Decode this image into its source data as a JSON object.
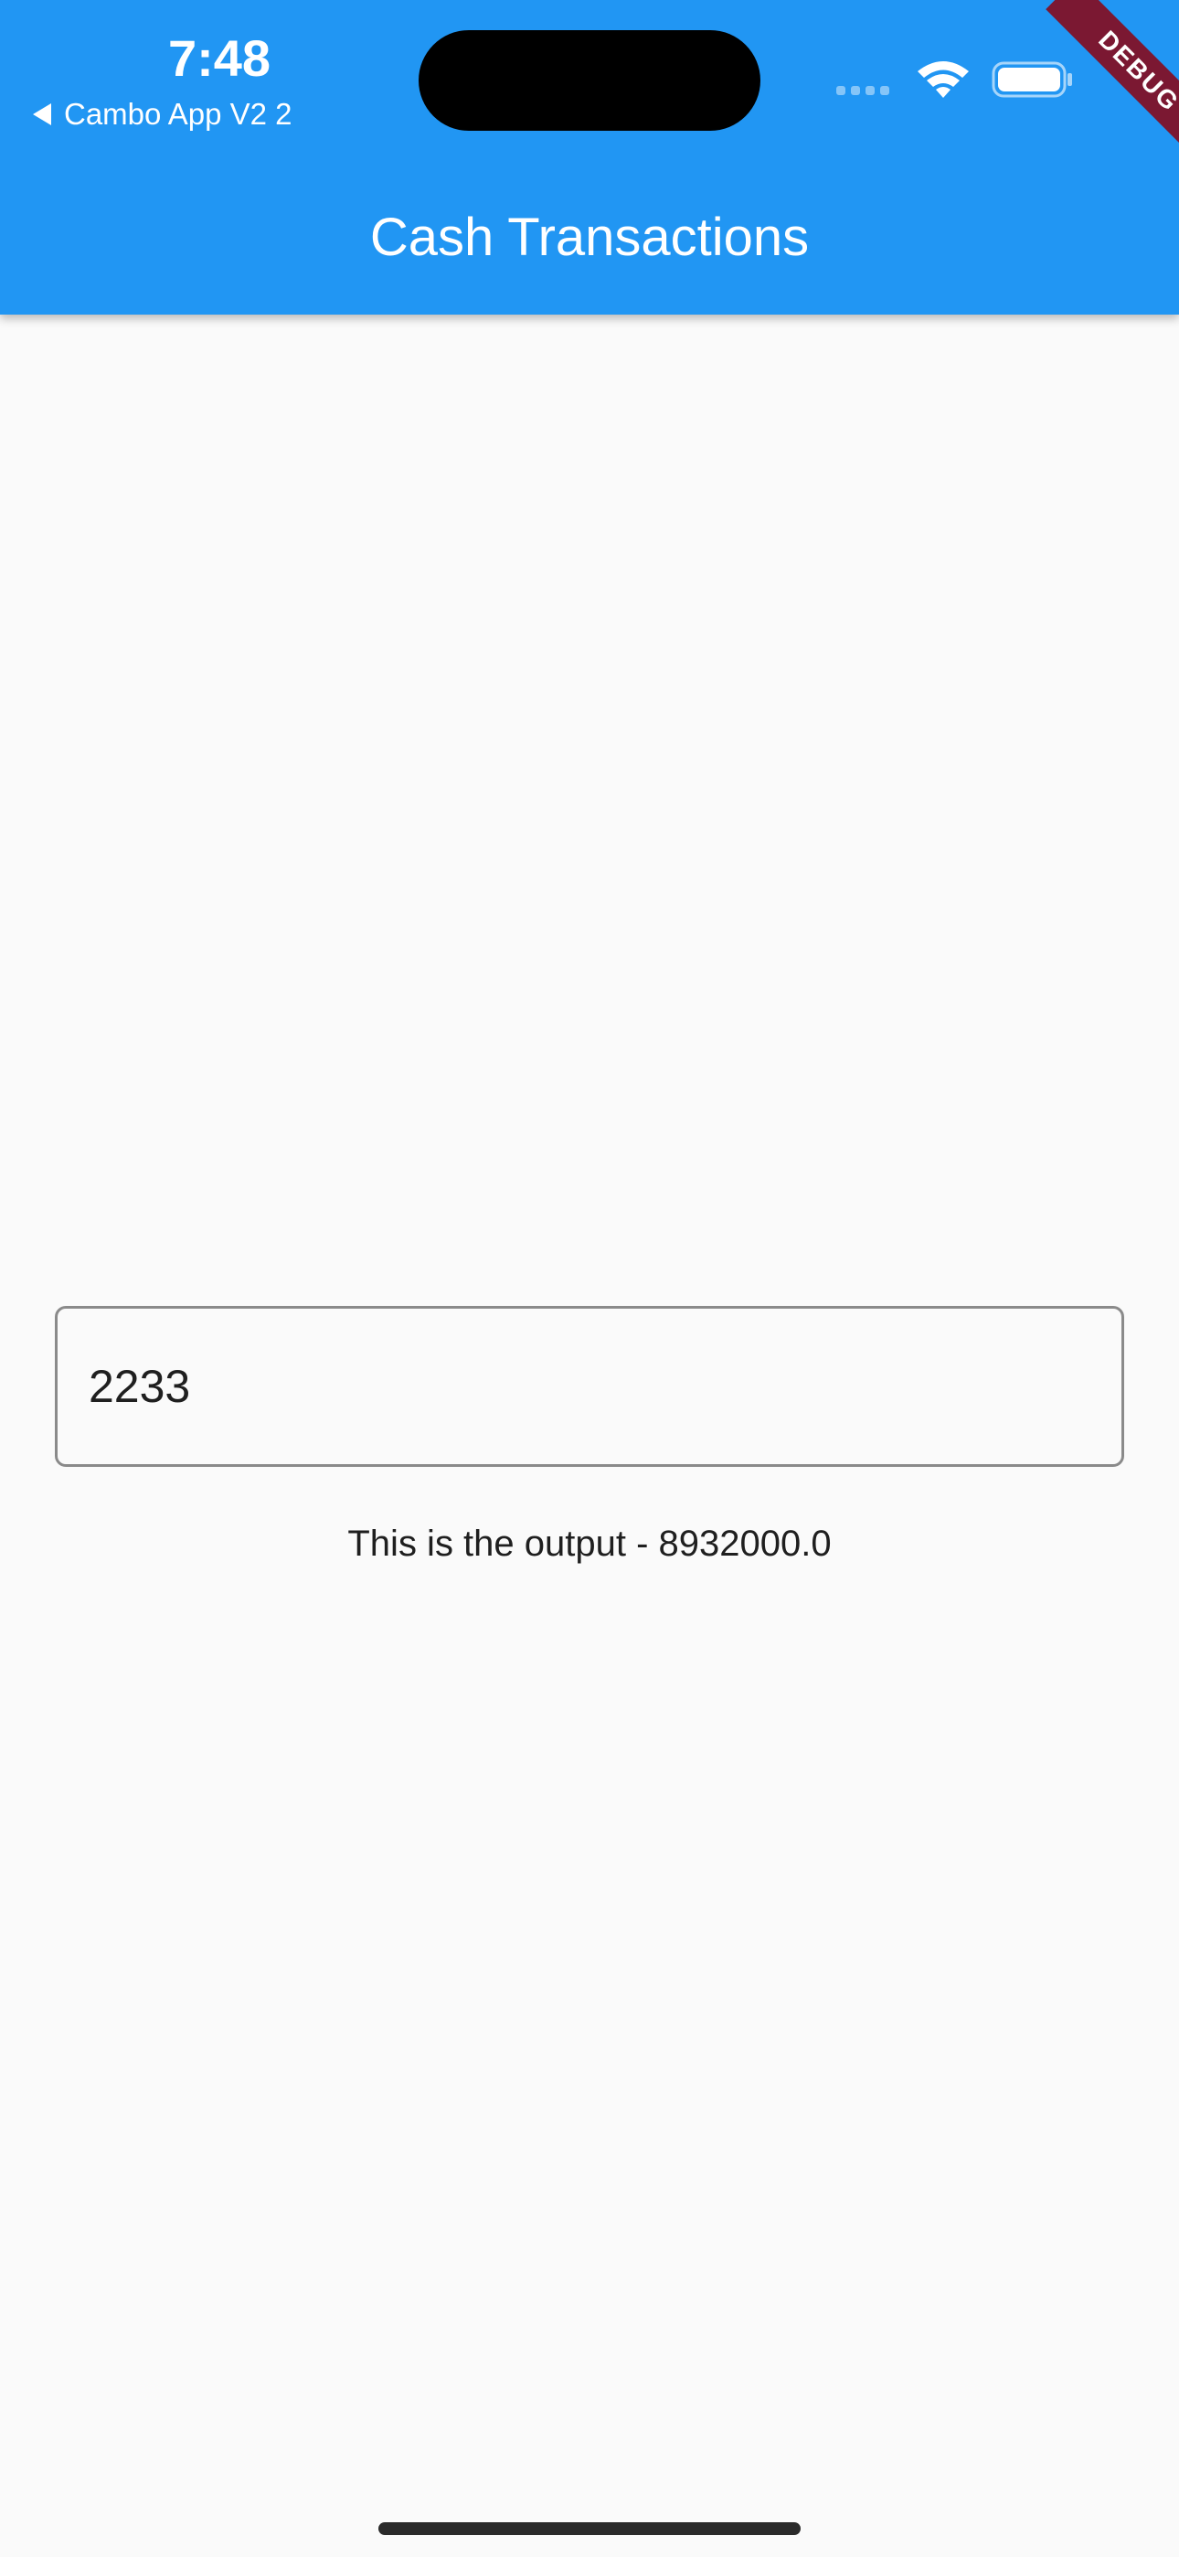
{
  "status_bar": {
    "time": "7:48",
    "back_app_label": "Cambo App V2 2",
    "debug_label": "DEBUG"
  },
  "app_bar": {
    "title": "Cash Transactions",
    "background_color": "#2196f3"
  },
  "form": {
    "amount_input_value": "2233",
    "output_text": "This is the output - 8932000.0"
  },
  "icons": [
    "back-triangle-icon",
    "cellular-signal-icon",
    "wifi-icon",
    "battery-icon"
  ],
  "colors": {
    "primary": "#2196f3",
    "debug_ribbon": "#7b1832",
    "background": "#fafafa"
  }
}
